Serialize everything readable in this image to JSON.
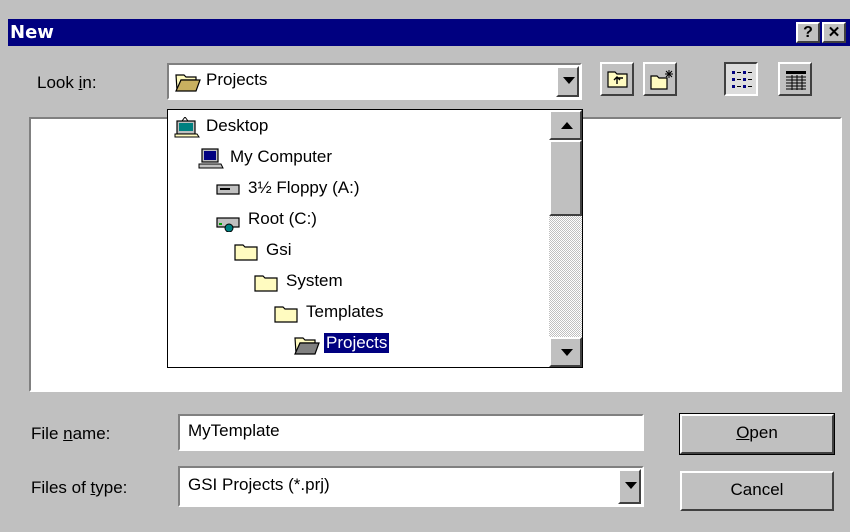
{
  "dialog": {
    "title": "New",
    "help_label": "?",
    "close_label": "✕"
  },
  "look_in": {
    "label_pre": "Look ",
    "label_accel": "i",
    "label_post": "n:",
    "value": "Projects"
  },
  "toolbar": {
    "up_one_level": "up-folder-icon",
    "new_folder": "new-folder-icon",
    "list_view": "list-view-icon",
    "details_view": "details-view-icon"
  },
  "folder_tree": {
    "items": [
      {
        "label": "Desktop",
        "icon": "desktop-icon"
      },
      {
        "label": "My Computer",
        "icon": "computer-icon"
      },
      {
        "label": "3½ Floppy (A:)",
        "icon": "floppy-drive-icon"
      },
      {
        "label": "Root (C:)",
        "icon": "hard-drive-icon"
      },
      {
        "label": "Gsi",
        "icon": "folder-icon"
      },
      {
        "label": "System",
        "icon": "folder-icon"
      },
      {
        "label": "Templates",
        "icon": "folder-icon"
      },
      {
        "label": "Projects",
        "icon": "open-folder-icon",
        "selected": true
      }
    ]
  },
  "file_name": {
    "label_pre": "File ",
    "label_accel": "n",
    "label_post": "ame:",
    "value": "MyTemplate"
  },
  "file_type": {
    "label_pre": "Files of ",
    "label_accel": "t",
    "label_post": "ype:",
    "value": "GSI Projects (*.prj)"
  },
  "buttons": {
    "open_accel": "O",
    "open_rest": "pen",
    "cancel": "Cancel"
  },
  "colors": {
    "titlebar": "#000080",
    "face": "#c0c0c0",
    "selection": "#000080"
  }
}
